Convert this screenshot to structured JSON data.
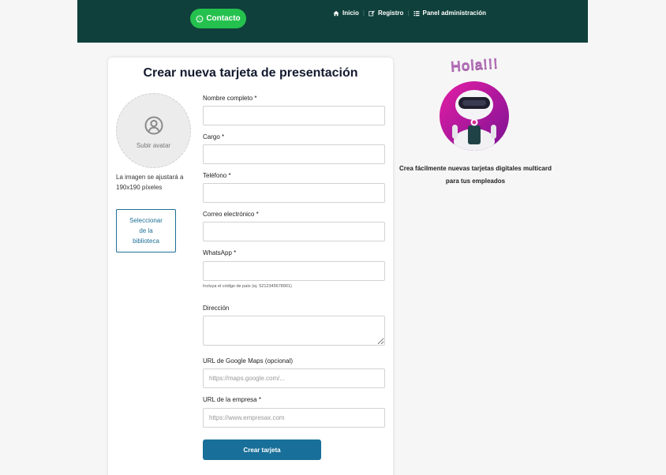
{
  "header": {
    "contact_label": "Contacto",
    "nav": [
      {
        "label": "Inicio",
        "icon": "home-icon"
      },
      {
        "label": "Registro",
        "icon": "edit-icon"
      },
      {
        "label": "Panel administración",
        "icon": "list-icon"
      }
    ]
  },
  "form": {
    "title": "Crear nueva tarjeta de presentación",
    "avatar_label": "Subir avatar",
    "image_note": "La imagen se ajustará a 190x190 píxeles",
    "library_button": "Seleccionar de la biblioteca",
    "fields": {
      "full_name": {
        "label": "Nombre completo *",
        "value": ""
      },
      "position": {
        "label": "Cargo *",
        "value": ""
      },
      "phone": {
        "label": "Teléfono *",
        "value": ""
      },
      "email": {
        "label": "Correo electrónico *",
        "value": ""
      },
      "whatsapp": {
        "label": "WhatsApp *",
        "value": "",
        "hint": "Incluya el código de país (ej. 5212345678901)"
      },
      "address": {
        "label": "Dirección",
        "value": ""
      },
      "maps_url": {
        "label": "URL de Google Maps (opcional)",
        "placeholder": "https://maps.google.com/..."
      },
      "company_url": {
        "label": "URL de la empresa *",
        "placeholder": "https://www.empresax.com"
      }
    },
    "submit_label": "Crear tarjeta"
  },
  "promo": {
    "greeting": "Hola!!!",
    "text": "Crea fácilmente nuevas tarjetas digitales multicard para tus empleados"
  },
  "colors": {
    "header_bg": "#0f403b",
    "whatsapp_green": "#25c14e",
    "primary_blue": "#186f99",
    "greeting_purple": "#b470b8"
  }
}
